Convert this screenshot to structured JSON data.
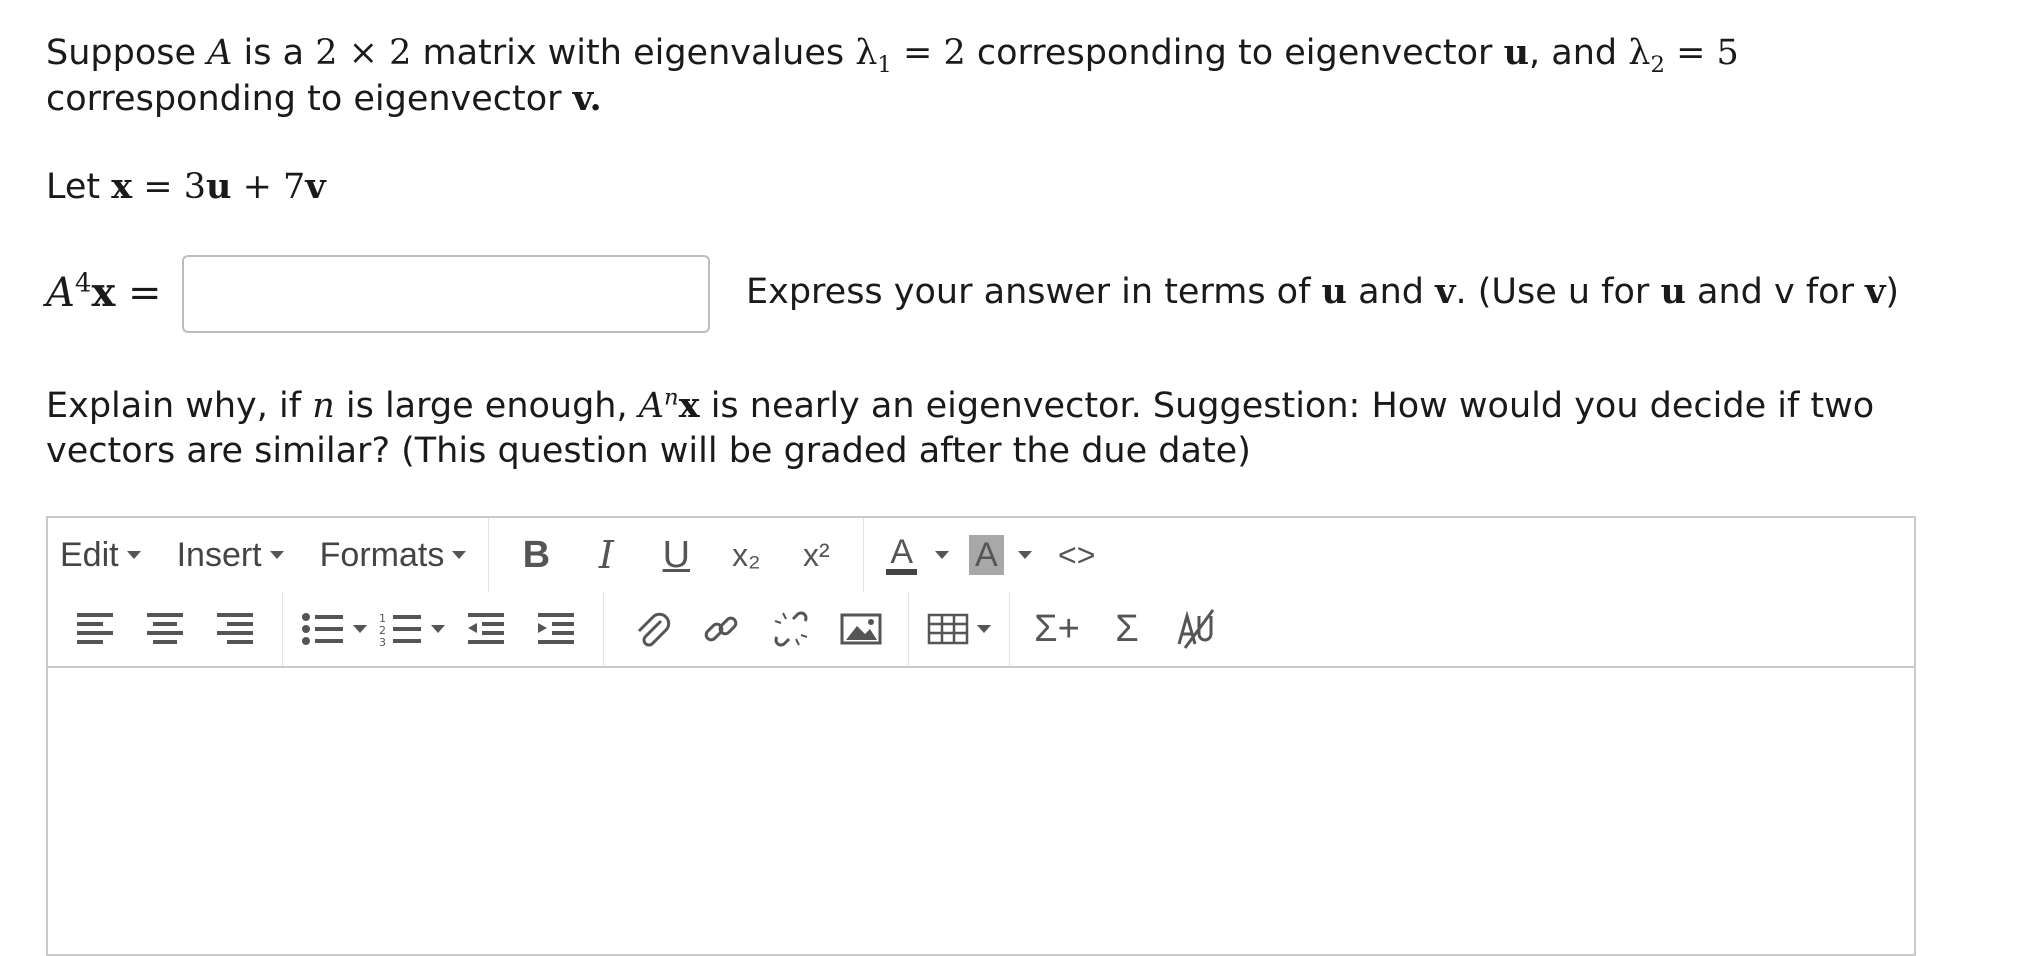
{
  "question": {
    "p1": {
      "t1": "Suppose ",
      "a": "A",
      "t2": " is a ",
      "dims": "2 × 2",
      "t3": " matrix with eigenvalues ",
      "lam": "λ",
      "sub1": "1",
      "eq1": " = 2",
      "t4": " corresponding to eigenvector ",
      "u": "u",
      "t5": ", and ",
      "sub2": "2",
      "eq2": " = 5",
      "t6": " corresponding to eigenvector ",
      "v": "v",
      "t7": "."
    },
    "p2": {
      "t1": "Let ",
      "x": "x",
      "eq": " = 3",
      "u": "u",
      "plus": " + 7",
      "v": "v"
    },
    "p3": {
      "lhs_a": "A",
      "lhs_exp": "4",
      "lhs_x": "x",
      "lhs_eq": " =",
      "answer_value": "",
      "h1": "Express your answer in terms of ",
      "u": "u",
      "h2": " and ",
      "v": "v",
      "h3": ". (Use u for ",
      "h4": " and v for ",
      "h5": ")"
    },
    "p4": {
      "t1": "Explain why, if ",
      "n": "n",
      "t2": " is large enough, ",
      "a": "A",
      "exp": "n",
      "x": "x",
      "t3": " is nearly an eigenvector. Suggestion: How would you decide if two vectors are similar? (This question will be graded after the due date)"
    }
  },
  "editor": {
    "menus": [
      "Edit",
      "Insert",
      "Formats"
    ],
    "icons": {
      "bold": "B",
      "italic": "I",
      "underline": "U",
      "subscript": "x₂",
      "superscript": "x²",
      "font_color": "A",
      "bg_color": "A",
      "code": "<>",
      "sum_plus": "Σ+",
      "sum": "Σ"
    },
    "colors": {
      "font_color_bar": "#444444",
      "bg_color_fill": "#a8a8a8",
      "border": "#c9c9c9"
    },
    "content": ""
  }
}
